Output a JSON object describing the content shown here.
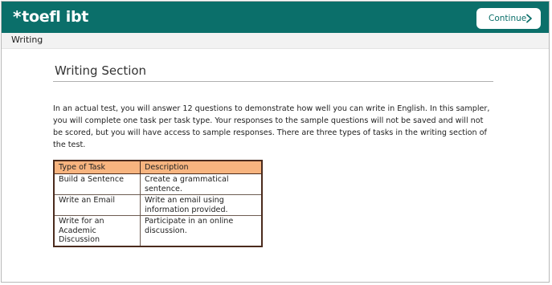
{
  "header": {
    "logo_text": "toefl ibt",
    "logo_star": "*",
    "continue_label": "Continue",
    "brand_color": "#0b6f6a"
  },
  "subbar": {
    "section": "Writing"
  },
  "main": {
    "title": "Writing Section",
    "intro": "In an actual test, you will answer 12 questions to demonstrate how well you can write in English. In this sampler, you will complete one task per task type. Your responses to the sample questions will not be saved and will not be scored, but you will have access to sample responses. There are three types of tasks in the writing section of the test.",
    "table": {
      "headers": [
        "Type of Task",
        "Description"
      ],
      "rows": [
        [
          "Build a Sentence",
          "Create a grammatical sentence."
        ],
        [
          "Write an Email",
          "Write an email using information provided."
        ],
        [
          "Write for an Academic Discussion",
          "Participate in an online discussion."
        ]
      ],
      "header_color": "#f7b47f"
    }
  }
}
